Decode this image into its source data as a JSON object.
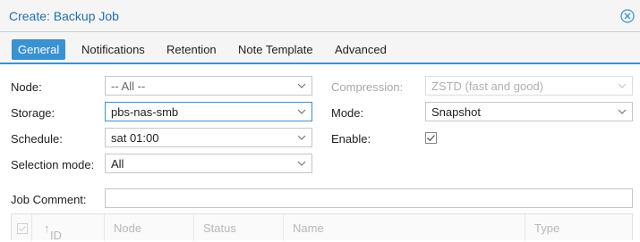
{
  "window": {
    "title": "Create: Backup Job"
  },
  "tabs": [
    {
      "label": "General",
      "active": true
    },
    {
      "label": "Notifications",
      "active": false
    },
    {
      "label": "Retention",
      "active": false
    },
    {
      "label": "Note Template",
      "active": false
    },
    {
      "label": "Advanced",
      "active": false
    }
  ],
  "form": {
    "node": {
      "label": "Node:",
      "value": "-- All --"
    },
    "storage": {
      "label": "Storage:",
      "value": "pbs-nas-smb"
    },
    "schedule": {
      "label": "Schedule:",
      "value": "sat 01:00"
    },
    "selection_mode": {
      "label": "Selection mode:",
      "value": "All"
    },
    "compression": {
      "label": "Compression:",
      "value": "ZSTD (fast and good)",
      "disabled": true
    },
    "mode": {
      "label": "Mode:",
      "value": "Snapshot"
    },
    "enable": {
      "label": "Enable:",
      "checked": true
    },
    "job_comment": {
      "label": "Job Comment:",
      "value": ""
    }
  },
  "grid": {
    "columns": [
      "ID",
      "Node",
      "Status",
      "Name",
      "Type"
    ],
    "sort_indicator": "↑"
  },
  "colors": {
    "accent": "#3892d4",
    "title": "#1f6fb5"
  },
  "icons": [
    "close-icon",
    "chevron-down-icon",
    "checkbox-icon",
    "sort-asc-icon"
  ]
}
